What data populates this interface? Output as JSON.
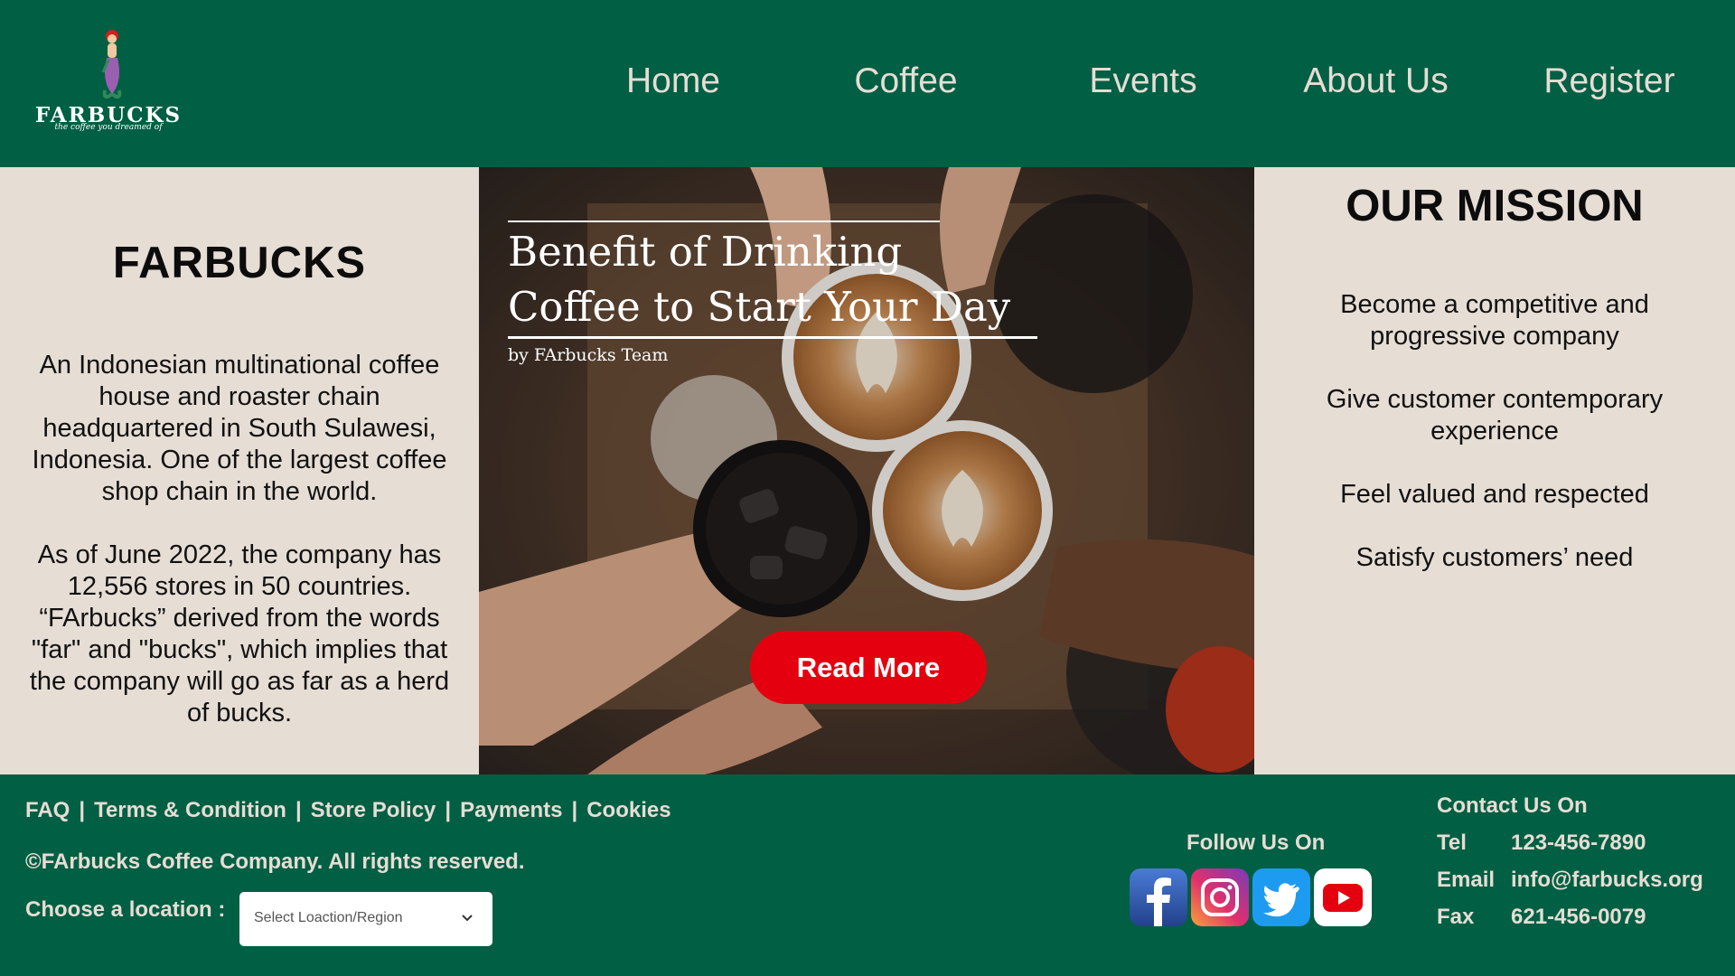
{
  "header": {
    "logo": {
      "name": "FARBUCKS",
      "tagline": "the coffee you dreamed of"
    },
    "nav": [
      {
        "label": "Home"
      },
      {
        "label": "Coffee"
      },
      {
        "label": "Events"
      },
      {
        "label": "About Us"
      },
      {
        "label": "Register"
      }
    ]
  },
  "about": {
    "title": "FARBUCKS",
    "paragraph1": "An Indonesian multinational coffee house and roaster chain headquartered in South Sulawesi, Indonesia. One of the largest coffee shop chain in the world.",
    "paragraph2": "As of June 2022, the company has 12,556 stores in 50 countries. “FArbucks” derived from the words \"far\" and \"bucks\", which implies that the company will go as far as a herd of bucks."
  },
  "hero": {
    "title_line1": "Benefit of Drinking",
    "title_line2": "Coffee to Start Your Day",
    "byline": "by FArbucks Team",
    "cta": "Read More"
  },
  "mission": {
    "title": "OUR MISSION",
    "items": [
      "Become a competitive and progressive company",
      "Give customer contemporary experience",
      "Feel valued and respected",
      "Satisfy customers’ need"
    ]
  },
  "footer": {
    "links": [
      "FAQ",
      "Terms & Condition",
      "Store Policy",
      "Payments",
      "Cookies"
    ],
    "separator": "|",
    "copyright": "©FArbucks Coffee Company. All rights reserved.",
    "choose_location": "Choose a location :",
    "select_placeholder": "Select Loaction/Region",
    "follow_label": "Follow Us On",
    "social": [
      "facebook-icon",
      "instagram-icon",
      "twitter-icon",
      "youtube-icon"
    ],
    "contact": {
      "title": "Contact Us On",
      "tel_label": "Tel",
      "tel": "123-456-7890",
      "email_label": "Email",
      "email": "info@farbucks.org",
      "fax_label": "Fax",
      "fax": "621-456-0079"
    }
  },
  "colors": {
    "brand_green": "#015f43",
    "cream": "#e6ddd5",
    "cta_red": "#e50010"
  }
}
